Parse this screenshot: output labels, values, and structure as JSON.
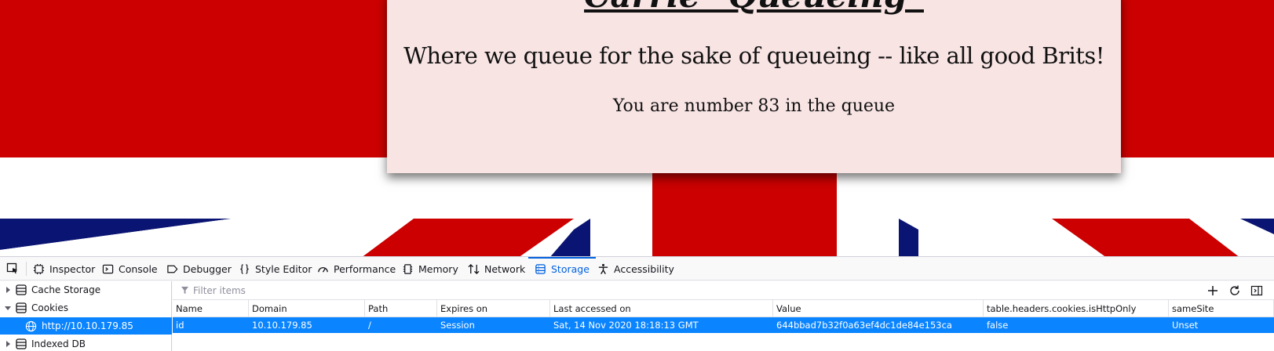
{
  "page": {
    "title": "Carrie \"Queueing\"",
    "tagline": "Where we queue for the sake of queueing -- like all good Brits!",
    "queue_status": "You are number 83 in the queue"
  },
  "devtools": {
    "tabs": [
      {
        "label": "Inspector",
        "icon": "inspector-icon"
      },
      {
        "label": "Console",
        "icon": "console-icon"
      },
      {
        "label": "Debugger",
        "icon": "debugger-icon"
      },
      {
        "label": "Style Editor",
        "icon": "style-editor-icon"
      },
      {
        "label": "Performance",
        "icon": "performance-icon"
      },
      {
        "label": "Memory",
        "icon": "memory-icon"
      },
      {
        "label": "Network",
        "icon": "network-icon"
      },
      {
        "label": "Storage",
        "icon": "storage-icon",
        "active": true
      },
      {
        "label": "Accessibility",
        "icon": "accessibility-icon"
      }
    ],
    "sidebar": {
      "items": [
        {
          "label": "Cache Storage",
          "expanded": false
        },
        {
          "label": "Cookies",
          "expanded": true
        },
        {
          "label": "http://10.10.179.85",
          "selected": true
        },
        {
          "label": "Indexed DB",
          "expanded": false
        }
      ]
    },
    "filter": {
      "placeholder": "Filter items",
      "value": ""
    },
    "table": {
      "headers": [
        "Name",
        "Domain",
        "Path",
        "Expires on",
        "Last accessed on",
        "Value",
        "table.headers.cookies.isHttpOnly",
        "sameSite"
      ],
      "rows": [
        [
          "id",
          "10.10.179.85",
          "/",
          "Session",
          "Sat, 14 Nov 2020 18:18:13 GMT",
          "644bbad7b32f0a63ef4dc1de84e153ca",
          "false",
          "Unset"
        ]
      ]
    },
    "colors": {
      "accent": "#0060df",
      "selection": "#0a84ff"
    }
  }
}
